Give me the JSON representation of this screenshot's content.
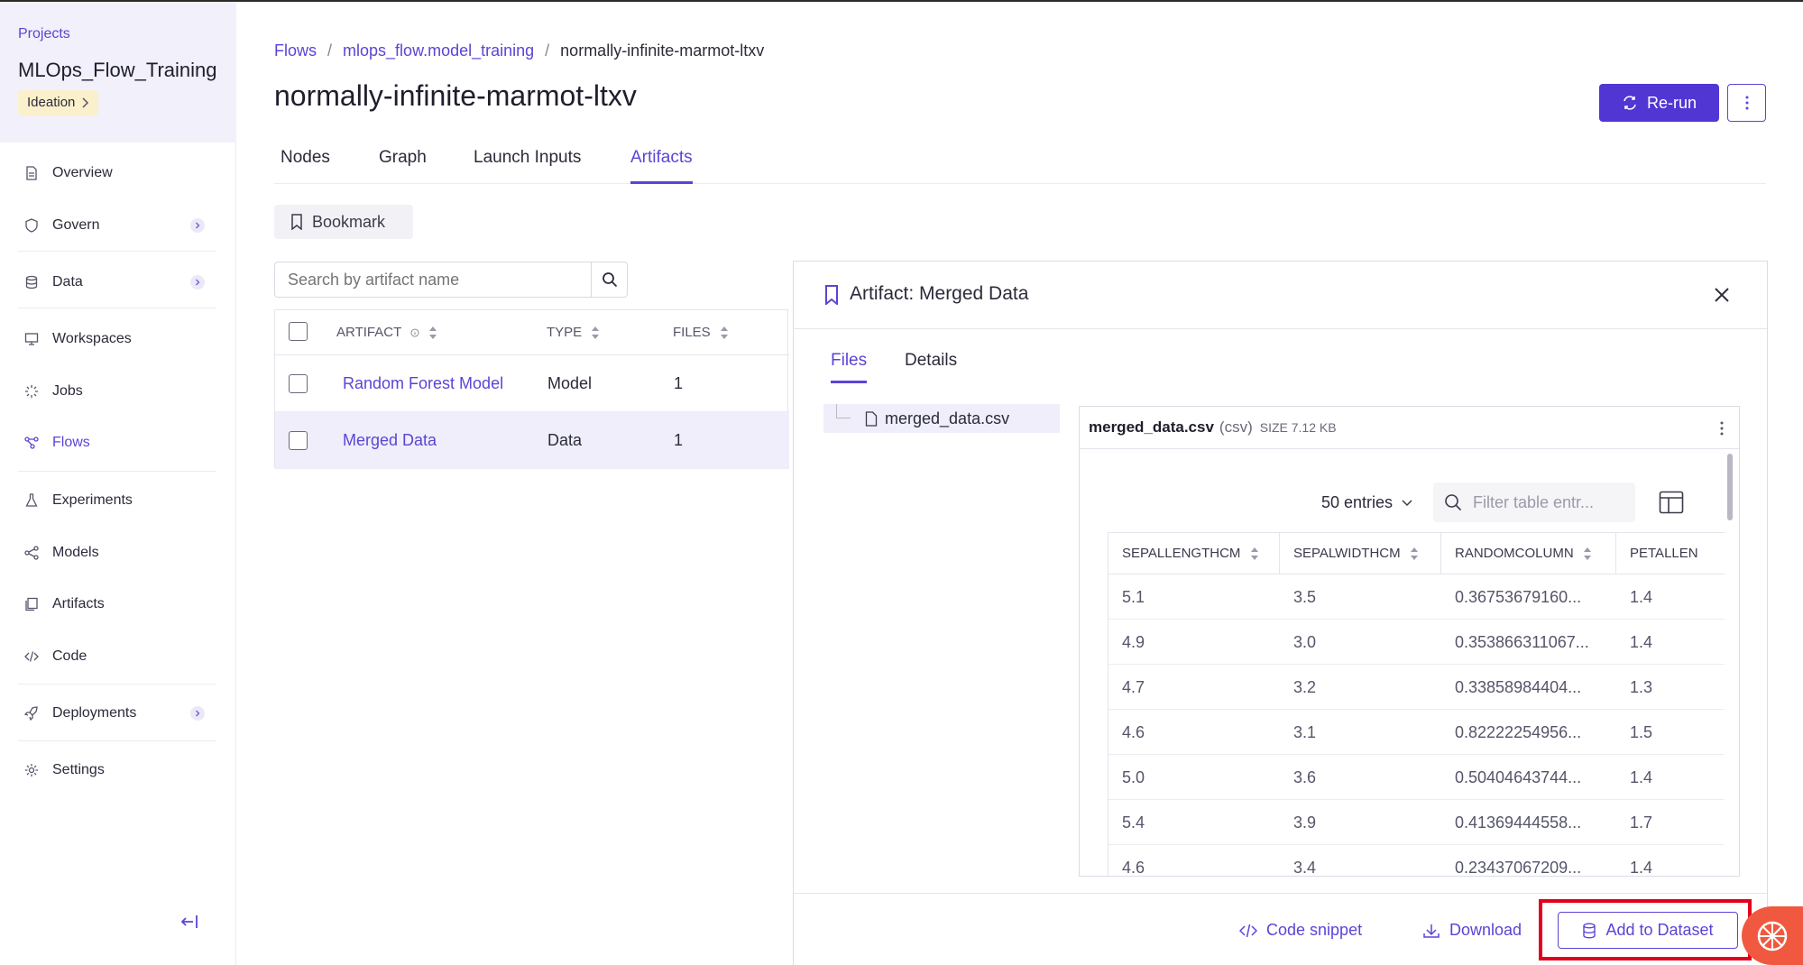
{
  "sidebar": {
    "projects_label": "Projects",
    "project_name": "MLOps_Flow_Training",
    "stage": "Ideation",
    "items": [
      {
        "label": "Overview",
        "icon": "document-icon"
      },
      {
        "label": "Govern",
        "icon": "shield-icon"
      },
      {
        "label": "Data",
        "icon": "database-icon"
      },
      {
        "label": "Workspaces",
        "icon": "monitor-icon"
      },
      {
        "label": "Jobs",
        "icon": "spinner-icon"
      },
      {
        "label": "Flows",
        "icon": "flow-icon"
      },
      {
        "label": "Experiments",
        "icon": "flask-icon"
      },
      {
        "label": "Models",
        "icon": "share-nodes-icon"
      },
      {
        "label": "Artifacts",
        "icon": "copy-icon"
      },
      {
        "label": "Code",
        "icon": "code-icon"
      },
      {
        "label": "Deployments",
        "icon": "rocket-icon"
      },
      {
        "label": "Settings",
        "icon": "gear-icon"
      }
    ]
  },
  "breadcrumb": {
    "flows": "Flows",
    "flow": "mlops_flow.model_training",
    "run": "normally-infinite-marmot-ltxv"
  },
  "page": {
    "title": "normally-infinite-marmot-ltxv",
    "rerun_label": "Re-run"
  },
  "tabs": [
    "Nodes",
    "Graph",
    "Launch Inputs",
    "Artifacts"
  ],
  "bookmark_label": "Bookmark",
  "search": {
    "placeholder": "Search by artifact name"
  },
  "artifacts_table": {
    "headers": {
      "artifact": "ARTIFACT",
      "type": "TYPE",
      "files": "FILES"
    },
    "rows": [
      {
        "name": "Random Forest Model",
        "type": "Model",
        "files": "1"
      },
      {
        "name": "Merged Data",
        "type": "Data",
        "files": "1"
      }
    ]
  },
  "panel": {
    "title": "Artifact: Merged Data",
    "tabs": [
      "Files",
      "Details"
    ],
    "file": "merged_data.csv",
    "preview": {
      "name": "merged_data.csv",
      "ext": "(csv)",
      "size": "SIZE 7.12 KB",
      "entries": "50 entries",
      "filter_placeholder": "Filter table entr...",
      "columns": [
        "SEPALLENGTHCM",
        "SEPALWIDTHCM",
        "RANDOMCOLUMN",
        "PETALLEN"
      ],
      "rows": [
        [
          "5.1",
          "3.5",
          "0.36753679160...",
          "1.4"
        ],
        [
          "4.9",
          "3.0",
          "0.353866311067...",
          "1.4"
        ],
        [
          "4.7",
          "3.2",
          "0.33858984404...",
          "1.3"
        ],
        [
          "4.6",
          "3.1",
          "0.82222254956...",
          "1.5"
        ],
        [
          "5.0",
          "3.6",
          "0.50404643744...",
          "1.4"
        ],
        [
          "5.4",
          "3.9",
          "0.41369444558...",
          "1.7"
        ],
        [
          "4.6",
          "3.4",
          "0.23437067209...",
          "1.4"
        ]
      ]
    },
    "footer": {
      "code_snippet": "Code snippet",
      "download": "Download",
      "add_to_dataset": "Add to Dataset"
    }
  },
  "colors": {
    "accent": "#5236d4",
    "highlight": "#e3001b",
    "assistant": "#f0593f"
  }
}
